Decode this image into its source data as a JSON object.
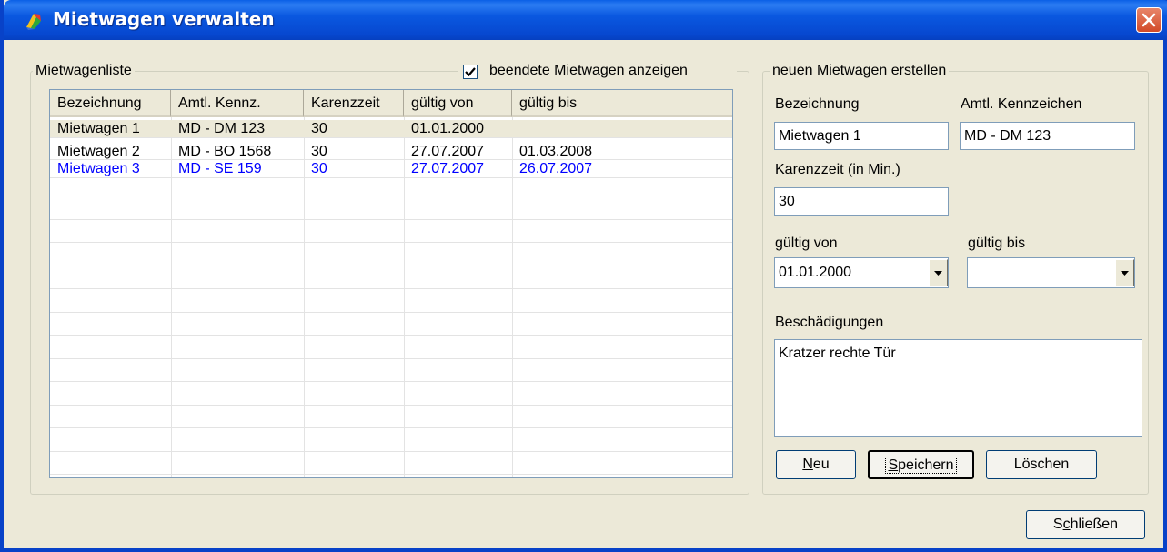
{
  "window": {
    "title": "Mietwagen verwalten",
    "title_icon": "app-icon",
    "close_icon": "close-icon"
  },
  "list_group": {
    "label": "Mietwagenliste",
    "show_finished_label": "beendete Mietwagen anzeigen",
    "show_finished_checked": true,
    "columns": [
      "Bezeichnung",
      "Amtl. Kennz.",
      "Karenzzeit",
      "gültig von",
      "gültig bis"
    ],
    "rows": [
      {
        "cells": [
          "Mietwagen 1",
          "MD - DM 123",
          "30",
          "01.01.2000",
          ""
        ],
        "selected": true,
        "color": "#000000"
      },
      {
        "cells": [
          "Mietwagen 2",
          "MD - BO 1568",
          "30",
          "27.07.2007",
          "01.03.2008"
        ],
        "selected": false,
        "color": "#000000"
      },
      {
        "cells": [
          "Mietwagen 3",
          "MD - SE 159",
          "30",
          "27.07.2007",
          "26.07.2007"
        ],
        "selected": false,
        "color": "#0000ff"
      }
    ]
  },
  "form_group": {
    "label": "neuen Mietwagen erstellen",
    "bezeichnung_label": "Bezeichnung",
    "bezeichnung_value": "Mietwagen 1",
    "kennzeichen_label": "Amtl. Kennzeichen",
    "kennzeichen_value": "MD - DM 123",
    "karenzzeit_label": "Karenzzeit (in Min.)",
    "karenzzeit_value": "30",
    "gueltig_von_label": "gültig von",
    "gueltig_von_value": "01.01.2000",
    "gueltig_bis_label": "gültig bis",
    "gueltig_bis_value": "",
    "beschaedigungen_label": "Beschädigungen",
    "beschaedigungen_value": "Kratzer rechte Tür",
    "neu_mnemonic": "N",
    "neu_rest": "eu",
    "speichern_mnemonic": "S",
    "speichern_rest": "peichern",
    "loeschen_label": "Löschen"
  },
  "footer": {
    "close_mnemonic": "c",
    "close_pre": "S",
    "close_rest": "hließen"
  },
  "colors": {
    "title_bar": "#0a58e0",
    "selected_row": "#ece9d8",
    "finished_row_text": "#0000ff"
  }
}
